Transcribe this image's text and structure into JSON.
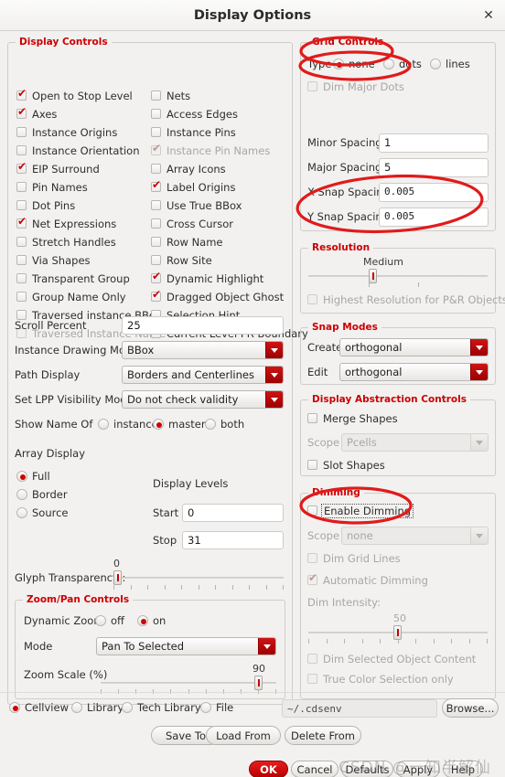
{
  "window": {
    "title": "Display Options",
    "close_icon": "close-icon"
  },
  "display_controls": {
    "legend": "Display Controls",
    "column1": [
      {
        "label": "Open to Stop Level",
        "checked": true,
        "disabled": false
      },
      {
        "label": "Axes",
        "checked": true,
        "disabled": false
      },
      {
        "label": "Instance Origins",
        "checked": false,
        "disabled": false
      },
      {
        "label": "Instance Orientation",
        "checked": false,
        "disabled": false
      },
      {
        "label": "EIP Surround",
        "checked": true,
        "disabled": false
      },
      {
        "label": "Pin Names",
        "checked": false,
        "disabled": false
      },
      {
        "label": "Dot Pins",
        "checked": false,
        "disabled": false
      },
      {
        "label": "Net Expressions",
        "checked": true,
        "disabled": false
      },
      {
        "label": "Stretch Handles",
        "checked": false,
        "disabled": false
      },
      {
        "label": "Via Shapes",
        "checked": false,
        "disabled": false
      },
      {
        "label": "Transparent Group",
        "checked": false,
        "disabled": false
      },
      {
        "label": "Group Name Only",
        "checked": false,
        "disabled": false
      },
      {
        "label": "Traversed instance BBox",
        "checked": false,
        "disabled": false
      },
      {
        "label": "Traversed Instance Name",
        "checked": false,
        "disabled": true
      }
    ],
    "column2": [
      {
        "label": "Nets",
        "checked": false,
        "disabled": false
      },
      {
        "label": "Access Edges",
        "checked": false,
        "disabled": false
      },
      {
        "label": "Instance Pins",
        "checked": false,
        "disabled": false
      },
      {
        "label": "Instance Pin Names",
        "checked": true,
        "disabled": true
      },
      {
        "label": "Array Icons",
        "checked": false,
        "disabled": false
      },
      {
        "label": "Label Origins",
        "checked": true,
        "disabled": false
      },
      {
        "label": "Use True BBox",
        "checked": false,
        "disabled": false
      },
      {
        "label": "Cross Cursor",
        "checked": false,
        "disabled": false
      },
      {
        "label": "Row Name",
        "checked": false,
        "disabled": false
      },
      {
        "label": "Row Site",
        "checked": false,
        "disabled": false
      },
      {
        "label": "Dynamic Highlight",
        "checked": true,
        "disabled": false
      },
      {
        "label": "Dragged Object Ghost",
        "checked": true,
        "disabled": false
      },
      {
        "label": "Selection Hint",
        "checked": false,
        "disabled": false
      },
      {
        "label": "Current Level PR Boundary",
        "checked": false,
        "disabled": false
      }
    ],
    "scroll_percent": {
      "label": "Scroll Percent",
      "value": "25"
    },
    "instance_drawing_mode": {
      "label": "Instance Drawing Mode",
      "value": "BBox"
    },
    "path_display": {
      "label": "Path Display",
      "value": "Borders and Centerlines"
    },
    "set_lpp_visibility_mode": {
      "label": "Set LPP Visibility Mode",
      "value": "Do not check validity"
    },
    "show_name_of": {
      "label": "Show Name Of",
      "options": [
        "instance",
        "master",
        "both"
      ],
      "selected": "master"
    },
    "array_display": {
      "label": "Array Display",
      "options": [
        "Full",
        "Border",
        "Source"
      ],
      "selected": "Full"
    },
    "display_levels": {
      "label": "Display Levels",
      "start_label": "Start",
      "start_value": "0",
      "stop_label": "Stop",
      "stop_value": "31"
    },
    "glyph_transparency": {
      "label": "Glyph Transparency :",
      "value": "0",
      "min": 0,
      "max": 100
    }
  },
  "zoom_pan_controls": {
    "legend": "Zoom/Pan Controls",
    "dynamic_zoom": {
      "label": "Dynamic Zoom",
      "options": [
        "off",
        "on"
      ],
      "selected": "on"
    },
    "mode": {
      "label": "Mode",
      "value": "Pan To Selected"
    },
    "zoom_scale": {
      "label": "Zoom Scale (%)",
      "value": "90",
      "min": 0,
      "max": 100
    }
  },
  "grid_controls": {
    "legend": "Grid Controls",
    "type": {
      "label": "Type",
      "options": [
        "none",
        "dots",
        "lines"
      ],
      "selected": "none"
    },
    "dim_major_dots": {
      "label": "Dim Major Dots",
      "checked": false,
      "disabled": true
    },
    "minor_spacing": {
      "label": "Minor Spacing",
      "value": "1"
    },
    "major_spacing": {
      "label": "Major Spacing",
      "value": "5"
    },
    "x_snap_spacing": {
      "label": "X Snap Spacing",
      "value": "0.005"
    },
    "y_snap_spacing": {
      "label": "Y Snap Spacing",
      "value": "0.005"
    }
  },
  "resolution": {
    "legend": "Resolution",
    "value_label": "Medium",
    "highest_resolution": {
      "label": "Highest Resolution for P&R Objects",
      "checked": false,
      "disabled": true
    }
  },
  "snap_modes": {
    "legend": "Snap Modes",
    "create": {
      "label": "Create",
      "value": "orthogonal"
    },
    "edit": {
      "label": "Edit",
      "value": "orthogonal"
    }
  },
  "display_abstraction_controls": {
    "legend": "Display Abstraction Controls",
    "merge_shapes": {
      "label": "Merge Shapes",
      "checked": false,
      "disabled": false
    },
    "scope": {
      "label": "Scope",
      "value": "Pcells",
      "disabled": true
    },
    "slot_shapes": {
      "label": "Slot Shapes",
      "checked": false,
      "disabled": false
    }
  },
  "dimming": {
    "legend": "Dimming",
    "enable_dimming": {
      "label": "Enable Dimming",
      "checked": false,
      "disabled": false
    },
    "scope": {
      "label": "Scope",
      "value": "none",
      "disabled": true
    },
    "dim_grid_lines": {
      "label": "Dim Grid Lines",
      "checked": false,
      "disabled": true
    },
    "automatic_dimming": {
      "label": "Automatic Dimming",
      "checked": true,
      "disabled": true
    },
    "dim_intensity": {
      "label": "Dim Intensity:",
      "value": "50",
      "min": 0,
      "max": 100
    },
    "dim_selected_object_content": {
      "label": "Dim Selected Object Content",
      "checked": false,
      "disabled": true
    },
    "true_color_selection_only": {
      "label": "True Color Selection only",
      "checked": false,
      "disabled": true
    }
  },
  "footer": {
    "scope_options": [
      "Cellview",
      "Library",
      "Tech Library",
      "File"
    ],
    "scope_selected": "Cellview",
    "path_value": "~/.cdsenv",
    "browse_label": "Browse...",
    "save_to_label": "Save To",
    "load_from_label": "Load From",
    "delete_from_label": "Delete From",
    "ok_label": "OK",
    "cancel_label": "Cancel",
    "defaults_label": "Defaults",
    "apply_label": "Apply",
    "help_label": "Help"
  },
  "watermark": {
    "text": "CSDN @一知半解仙"
  },
  "colors": {
    "accent_red": "#cc0000",
    "annotation_red": "#e01b1b",
    "background": "#f2f1f0"
  }
}
